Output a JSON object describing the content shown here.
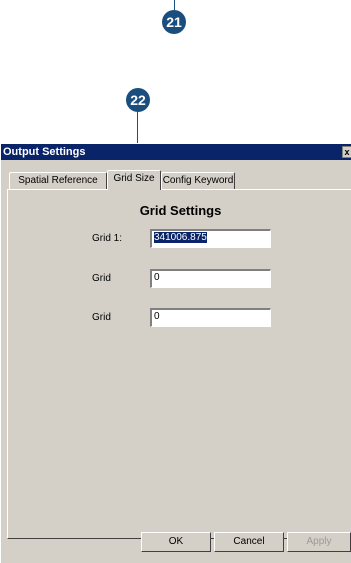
{
  "callouts": {
    "top": "21",
    "second": "22"
  },
  "window": {
    "title": "Output Settings",
    "close_glyph": "x"
  },
  "tabs": [
    {
      "label": "Spatial Reference"
    },
    {
      "label": "Grid Size"
    },
    {
      "label": "Config Keyword"
    }
  ],
  "panel": {
    "heading": "Grid Settings"
  },
  "fields": [
    {
      "label": "Grid 1:",
      "value": "341006.875"
    },
    {
      "label": "Grid",
      "value": "0"
    },
    {
      "label": "Grid",
      "value": "0"
    }
  ],
  "buttons": {
    "ok": "OK",
    "cancel": "Cancel",
    "apply": "Apply"
  },
  "colors": {
    "callout": "#1a4e7e",
    "titlebar": "#0a246a",
    "dialog": "#d4d0c8"
  }
}
